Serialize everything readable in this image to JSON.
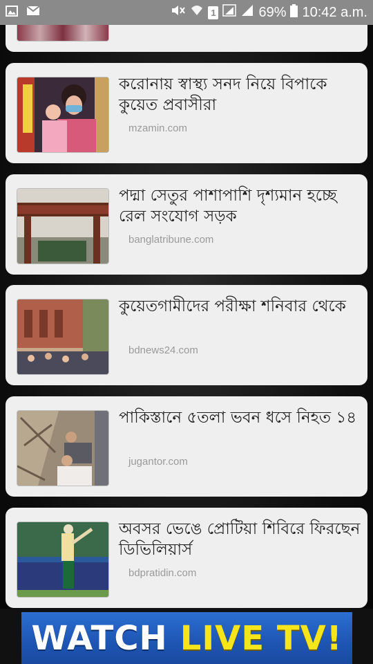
{
  "status_bar": {
    "battery": "69%",
    "time": "10:42 a.m.",
    "sim_slot": "1",
    "icons": [
      "gallery-icon",
      "mail-icon",
      "mute-icon",
      "wifi-icon",
      "sim-icon",
      "signal-icon",
      "battery-icon"
    ]
  },
  "articles": [
    {
      "title": "করোনায় স্বাস্থ্য সনদ নিয়ে বিপাকে কুয়েত প্রবাসীরা",
      "source": "mzamin.com"
    },
    {
      "title": "পদ্মা সেতুর পাশাপাশি দৃশ্যমান হচ্ছে রেল সংযোগ সড়ক",
      "source": "banglatribune.com"
    },
    {
      "title": "কুয়েতগামীদের পরীক্ষা শনিবার থেকে",
      "source": "bdnews24.com"
    },
    {
      "title": "পাকিস্তানে ৫তলা ভবন ধসে নিহত ১৪",
      "source": "jugantor.com"
    },
    {
      "title": "অবসর ভেঙে প্রোটিয়া শিবিরে ফিরছেন ডিভিলিয়ার্স",
      "source": "bdpratidin.com"
    }
  ],
  "banner": {
    "word1": "WATCH",
    "word2": "LIVE TV!"
  }
}
